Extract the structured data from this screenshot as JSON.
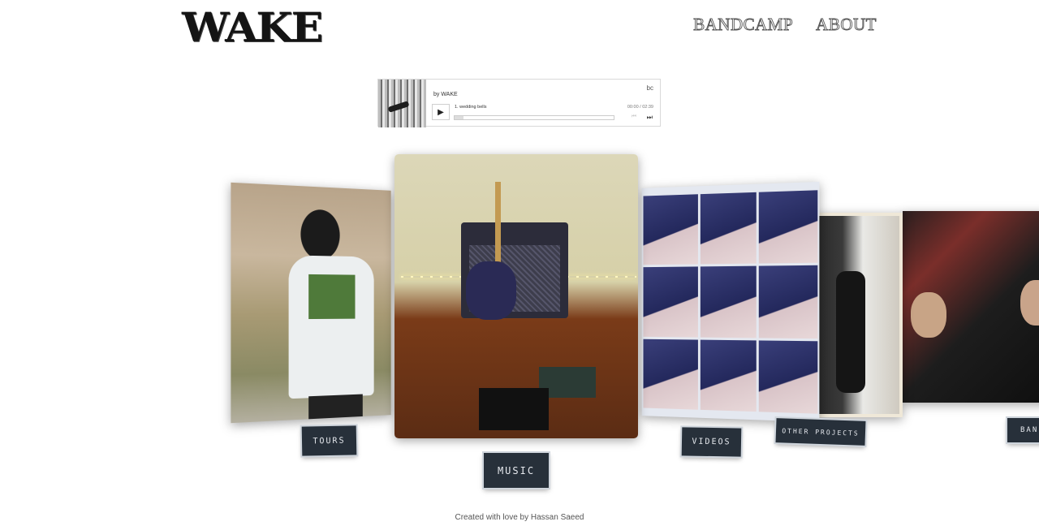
{
  "header": {
    "logo": "WAKE",
    "nav": [
      {
        "label": "BANDCAMP"
      },
      {
        "label": "ABOUT"
      }
    ]
  },
  "player": {
    "logo": "bc",
    "by": "by WAKE",
    "play_icon": "▶",
    "track": "1.  wedding bells",
    "time": "00:00 / 02:39",
    "progress": 0,
    "prev_icon": "⏮",
    "next_icon": "⏭"
  },
  "carousel": {
    "labels": {
      "tours": "TOURS",
      "music": "MUSIC",
      "videos": "VIDEOS",
      "other": "OTHER PROJECTS",
      "band": "BAN"
    }
  },
  "footer": {
    "text": "Created with love by Hassan Saeed"
  }
}
